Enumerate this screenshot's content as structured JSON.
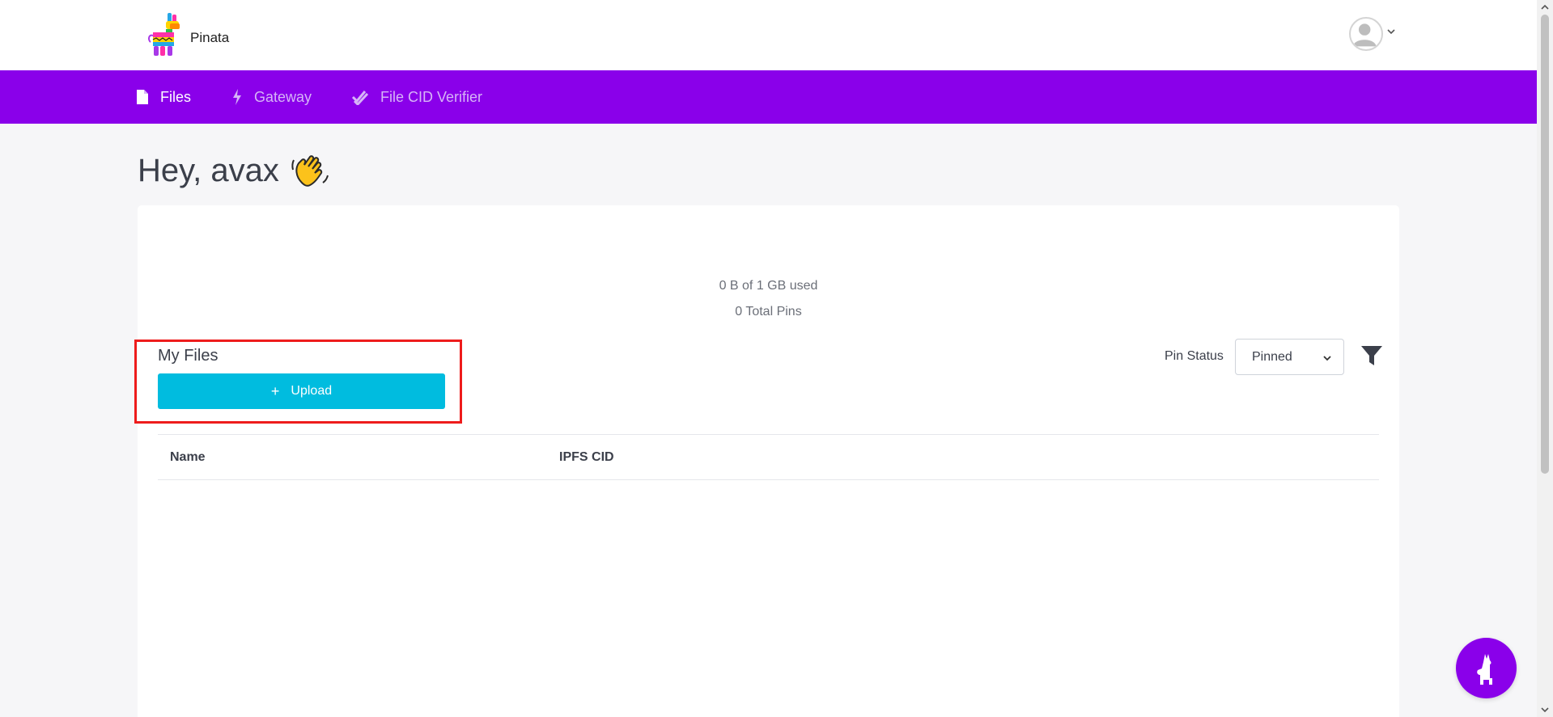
{
  "header": {
    "brand": "Pinata"
  },
  "nav": {
    "items": [
      {
        "label": "Files",
        "icon": "file-icon",
        "active": true
      },
      {
        "label": "Gateway",
        "icon": "bolt-icon",
        "active": false
      },
      {
        "label": "File CID Verifier",
        "icon": "double-check-icon",
        "active": false
      }
    ]
  },
  "main": {
    "greeting": "Hey, avax",
    "usage_storage": "0 B of 1 GB used",
    "usage_pins": "0 Total Pins",
    "files_title": "My Files",
    "upload_label": "Upload",
    "pin_status_label": "Pin Status",
    "pin_status_value": "Pinned",
    "table_columns": [
      "Name",
      "IPFS CID"
    ]
  },
  "colors": {
    "nav_bg": "#8a00ea",
    "upload_bg": "#00bcdf",
    "highlight": "#ee1c1c"
  }
}
